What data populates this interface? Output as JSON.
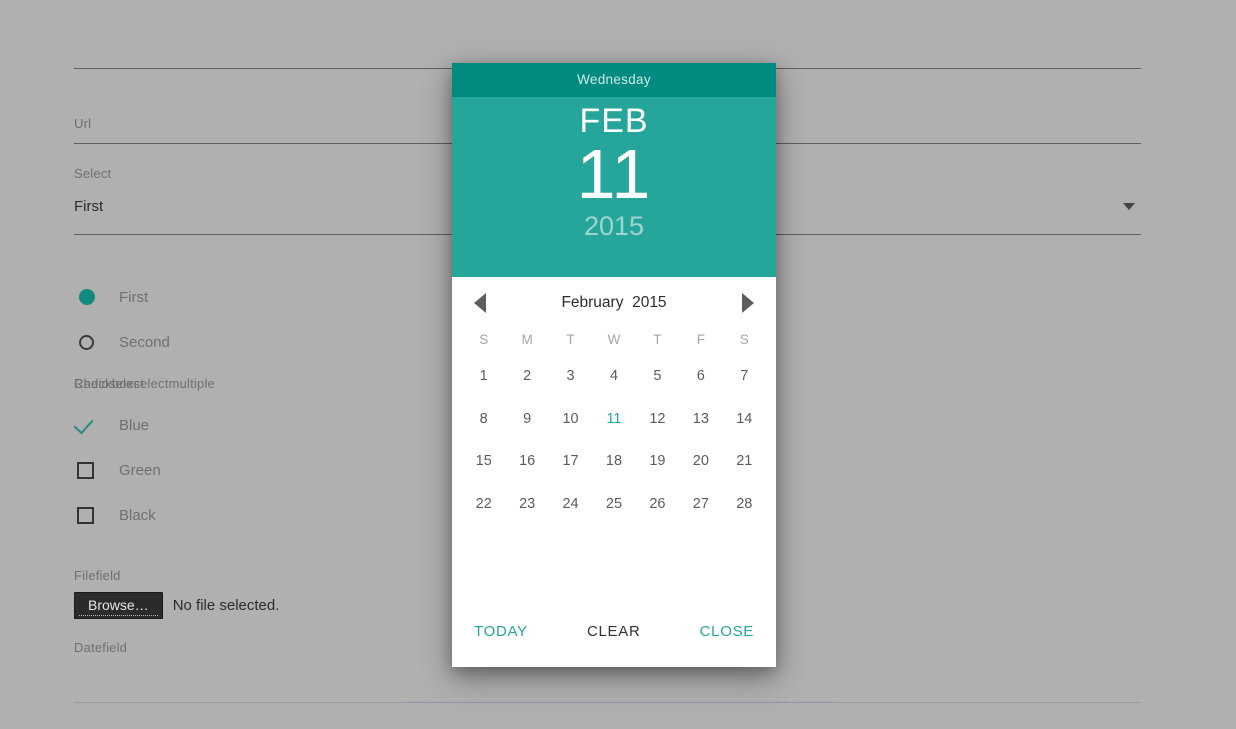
{
  "background": {
    "color": "#b0b0b0"
  },
  "theme": {
    "accent": "#26a69a",
    "accent_dark": "#008b80",
    "year_text": "#9ed4cd",
    "label": "#6f6f6f"
  },
  "form": {
    "fields": [
      {
        "label": "Url",
        "value": "",
        "type": "text"
      },
      {
        "label": "Select",
        "value": "First",
        "type": "select"
      },
      {
        "label": "Radioselect",
        "value": "",
        "type": "radio-group"
      },
      {
        "label": "Checkboxselectmultiple",
        "value": "",
        "type": "checkbox-group"
      },
      {
        "label": "Filefield",
        "value": "",
        "type": "file"
      },
      {
        "label": "Datefield",
        "value": "",
        "type": "date"
      }
    ],
    "url_label": "Url",
    "select_label": "Select",
    "select_value": "First",
    "radio_label": "Radioselect",
    "radio_options": [
      {
        "label": "First",
        "selected": true
      },
      {
        "label": "Second",
        "selected": false
      }
    ],
    "checkbox_label": "Checkboxselectmultiple",
    "checkbox_options": [
      {
        "label": "Blue",
        "checked": true
      },
      {
        "label": "Green",
        "checked": false
      },
      {
        "label": "Black",
        "checked": false
      }
    ],
    "file_label": "Filefield",
    "file_button": "Browse…",
    "file_status": "No file selected.",
    "date_label": "Datefield",
    "date_value": ""
  },
  "datepicker": {
    "weekday": "Wednesday",
    "month_abbr": "FEB",
    "day": "11",
    "year": "2015",
    "title": "February  2015",
    "prev_icon": "triangle-left-icon",
    "next_icon": "triangle-right-icon",
    "weekday_headers": [
      "S",
      "M",
      "T",
      "W",
      "T",
      "F",
      "S"
    ],
    "weeks": [
      [
        "1",
        "2",
        "3",
        "4",
        "5",
        "6",
        "7"
      ],
      [
        "8",
        "9",
        "10",
        "11",
        "12",
        "13",
        "14"
      ],
      [
        "15",
        "16",
        "17",
        "18",
        "19",
        "20",
        "21"
      ],
      [
        "22",
        "23",
        "24",
        "25",
        "26",
        "27",
        "28"
      ],
      [
        "",
        "",
        "",
        "",
        "",
        "",
        ""
      ]
    ],
    "selected_day": "11",
    "footer": {
      "today": "TODAY",
      "clear": "CLEAR",
      "close": "CLOSE"
    }
  }
}
